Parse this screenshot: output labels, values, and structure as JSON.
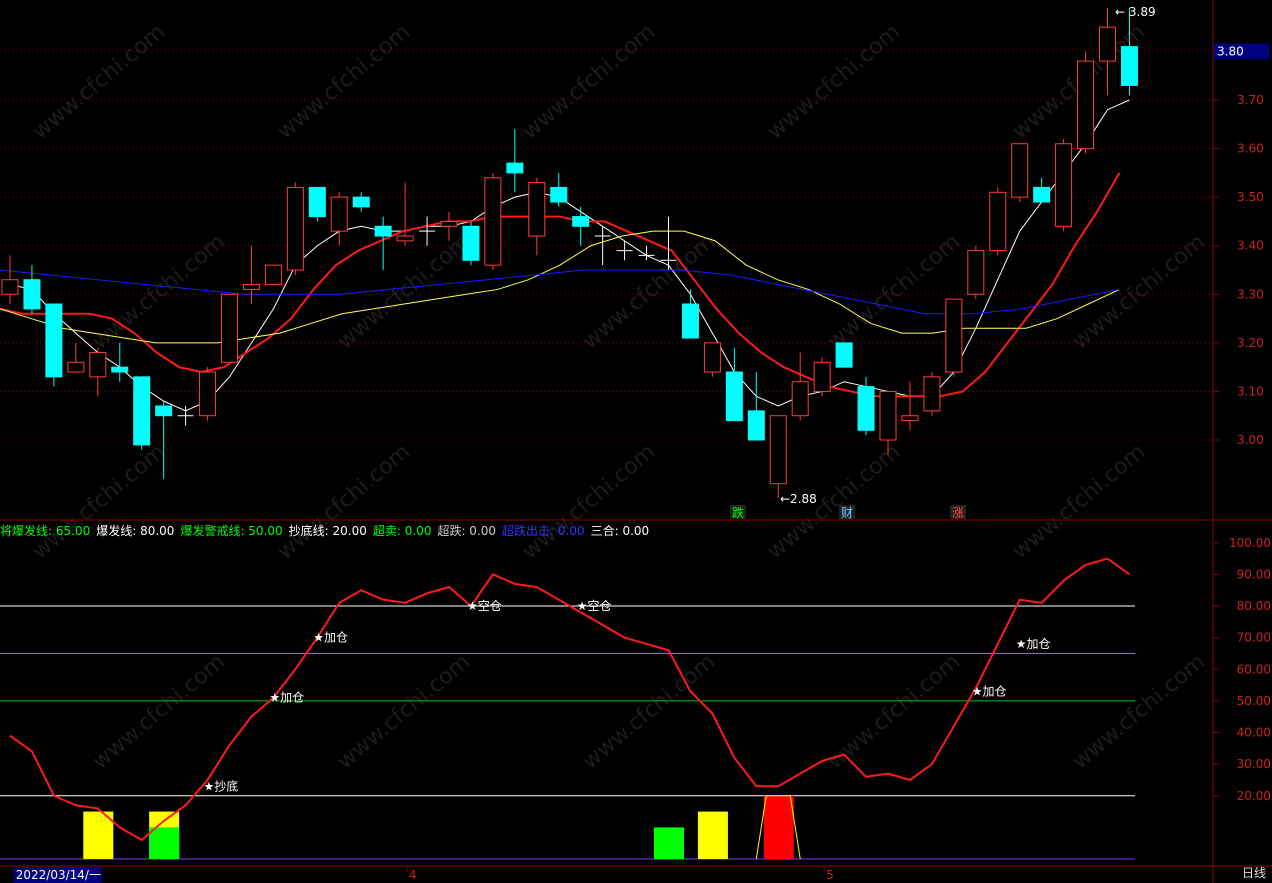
{
  "chart_data": [
    {
      "type": "candlestick",
      "yaxis": {
        "ylim": [
          2.9,
          3.95
        ],
        "ticks": [
          3.0,
          3.1,
          3.2,
          3.3,
          3.4,
          3.5,
          3.6,
          3.7
        ],
        "tick_labels": [
          "3.00",
          "3.10",
          "3.20",
          "3.30",
          "3.40",
          "3.50",
          "3.60",
          "3.70"
        ]
      },
      "price_marker": {
        "value": 3.8,
        "label": "3.80"
      },
      "candles": [
        {
          "o": 3.3,
          "h": 3.38,
          "l": 3.28,
          "c": 3.33
        },
        {
          "o": 3.33,
          "h": 3.36,
          "l": 3.26,
          "c": 3.27
        },
        {
          "o": 3.28,
          "h": 3.28,
          "l": 3.11,
          "c": 3.13
        },
        {
          "o": 3.14,
          "h": 3.2,
          "l": 3.14,
          "c": 3.16
        },
        {
          "o": 3.13,
          "h": 3.19,
          "l": 3.09,
          "c": 3.18
        },
        {
          "o": 3.15,
          "h": 3.2,
          "l": 3.12,
          "c": 3.14
        },
        {
          "o": 3.13,
          "h": 3.13,
          "l": 2.98,
          "c": 2.99
        },
        {
          "o": 3.07,
          "h": 3.08,
          "l": 2.92,
          "c": 3.05
        },
        {
          "o": 3.05,
          "h": 3.07,
          "l": 3.03,
          "c": 3.05
        },
        {
          "o": 3.05,
          "h": 3.15,
          "l": 3.04,
          "c": 3.14
        },
        {
          "o": 3.16,
          "h": 3.3,
          "l": 3.16,
          "c": 3.3
        },
        {
          "o": 3.31,
          "h": 3.4,
          "l": 3.28,
          "c": 3.32
        },
        {
          "o": 3.32,
          "h": 3.36,
          "l": 3.32,
          "c": 3.36
        },
        {
          "o": 3.35,
          "h": 3.53,
          "l": 3.34,
          "c": 3.52
        },
        {
          "o": 3.52,
          "h": 3.52,
          "l": 3.45,
          "c": 3.46
        },
        {
          "o": 3.43,
          "h": 3.51,
          "l": 3.4,
          "c": 3.5
        },
        {
          "o": 3.5,
          "h": 3.51,
          "l": 3.47,
          "c": 3.48
        },
        {
          "o": 3.44,
          "h": 3.46,
          "l": 3.35,
          "c": 3.42
        },
        {
          "o": 3.41,
          "h": 3.53,
          "l": 3.4,
          "c": 3.42
        },
        {
          "o": 3.43,
          "h": 3.46,
          "l": 3.4,
          "c": 3.43
        },
        {
          "o": 3.44,
          "h": 3.47,
          "l": 3.41,
          "c": 3.45
        },
        {
          "o": 3.44,
          "h": 3.45,
          "l": 3.36,
          "c": 3.37
        },
        {
          "o": 3.36,
          "h": 3.55,
          "l": 3.35,
          "c": 3.54
        },
        {
          "o": 3.57,
          "h": 3.64,
          "l": 3.51,
          "c": 3.55
        },
        {
          "o": 3.42,
          "h": 3.54,
          "l": 3.38,
          "c": 3.53
        },
        {
          "o": 3.52,
          "h": 3.55,
          "l": 3.48,
          "c": 3.49
        },
        {
          "o": 3.46,
          "h": 3.48,
          "l": 3.4,
          "c": 3.44
        },
        {
          "o": 3.42,
          "h": 3.44,
          "l": 3.36,
          "c": 3.42
        },
        {
          "o": 3.39,
          "h": 3.41,
          "l": 3.37,
          "c": 3.39
        },
        {
          "o": 3.38,
          "h": 3.4,
          "l": 3.37,
          "c": 3.38
        },
        {
          "o": 3.37,
          "h": 3.46,
          "l": 3.35,
          "c": 3.37
        },
        {
          "o": 3.28,
          "h": 3.31,
          "l": 3.21,
          "c": 3.21
        },
        {
          "o": 3.14,
          "h": 3.2,
          "l": 3.13,
          "c": 3.2
        },
        {
          "o": 3.14,
          "h": 3.19,
          "l": 3.04,
          "c": 3.04
        },
        {
          "o": 3.06,
          "h": 3.14,
          "l": 3.02,
          "c": 3.0
        },
        {
          "o": 2.91,
          "h": 3.04,
          "l": 2.88,
          "c": 3.05
        },
        {
          "o": 3.05,
          "h": 3.18,
          "l": 3.04,
          "c": 3.12
        },
        {
          "o": 3.1,
          "h": 3.17,
          "l": 3.09,
          "c": 3.16
        },
        {
          "o": 3.2,
          "h": 3.2,
          "l": 3.15,
          "c": 3.15
        },
        {
          "o": 3.11,
          "h": 3.13,
          "l": 3.01,
          "c": 3.02
        },
        {
          "o": 3.0,
          "h": 3.1,
          "l": 2.97,
          "c": 3.1
        },
        {
          "o": 3.04,
          "h": 3.12,
          "l": 3.02,
          "c": 3.05
        },
        {
          "o": 3.06,
          "h": 3.14,
          "l": 3.05,
          "c": 3.13
        },
        {
          "o": 3.14,
          "h": 3.29,
          "l": 3.13,
          "c": 3.29
        },
        {
          "o": 3.3,
          "h": 3.4,
          "l": 3.29,
          "c": 3.39
        },
        {
          "o": 3.39,
          "h": 3.52,
          "l": 3.38,
          "c": 3.51
        },
        {
          "o": 3.5,
          "h": 3.61,
          "l": 3.49,
          "c": 3.61
        },
        {
          "o": 3.52,
          "h": 3.54,
          "l": 3.49,
          "c": 3.49
        },
        {
          "o": 3.44,
          "h": 3.62,
          "l": 3.43,
          "c": 3.61
        },
        {
          "o": 3.6,
          "h": 3.8,
          "l": 3.59,
          "c": 3.78
        },
        {
          "o": 3.78,
          "h": 3.89,
          "l": 3.71,
          "c": 3.85
        },
        {
          "o": 3.81,
          "h": 3.89,
          "l": 3.71,
          "c": 3.73
        }
      ],
      "series": [
        {
          "color": "#ffffff",
          "values": [
            3.32,
            3.31,
            3.26,
            3.22,
            3.18,
            3.15,
            3.11,
            3.08,
            3.06,
            3.08,
            3.13,
            3.2,
            3.27,
            3.36,
            3.4,
            3.43,
            3.44,
            3.43,
            3.43,
            3.44,
            3.44,
            3.45,
            3.48,
            3.5,
            3.51,
            3.5,
            3.47,
            3.44,
            3.41,
            3.38,
            3.36,
            3.3,
            3.22,
            3.14,
            3.09,
            3.07,
            3.09,
            3.1,
            3.12,
            3.11,
            3.1,
            3.09,
            3.09,
            3.14,
            3.23,
            3.33,
            3.43,
            3.49,
            3.55,
            3.61,
            3.68,
            3.7
          ]
        },
        {
          "color": "#ff1a1a",
          "values": [
            3.27,
            3.26,
            3.26,
            3.26,
            3.26,
            3.25,
            3.22,
            3.18,
            3.15,
            3.14,
            3.15,
            3.18,
            3.21,
            3.25,
            3.31,
            3.36,
            3.39,
            3.41,
            3.43,
            3.44,
            3.45,
            3.45,
            3.46,
            3.46,
            3.46,
            3.46,
            3.45,
            3.45,
            3.43,
            3.41,
            3.39,
            3.33,
            3.27,
            3.22,
            3.18,
            3.15,
            3.13,
            3.11,
            3.1,
            3.09,
            3.09,
            3.09,
            3.09,
            3.1,
            3.14,
            3.2,
            3.26,
            3.32,
            3.4,
            3.47,
            3.55
          ]
        },
        {
          "color": "#ffff55",
          "values": [
            3.27,
            3.25,
            3.23,
            3.22,
            3.21,
            3.2,
            3.2,
            3.2,
            3.21,
            3.22,
            3.24,
            3.26,
            3.27,
            3.28,
            3.29,
            3.3,
            3.31,
            3.33,
            3.36,
            3.4,
            3.42,
            3.43,
            3.43,
            3.41,
            3.36,
            3.33,
            3.31,
            3.28,
            3.24,
            3.22,
            3.22,
            3.23,
            3.23,
            3.23,
            3.25,
            3.28,
            3.31
          ]
        },
        {
          "color": "#1a1aff",
          "values": [
            3.35,
            3.34,
            3.33,
            3.32,
            3.31,
            3.3,
            3.3,
            3.3,
            3.31,
            3.32,
            3.33,
            3.34,
            3.35,
            3.35,
            3.35,
            3.34,
            3.32,
            3.3,
            3.28,
            3.26,
            3.26,
            3.27,
            3.29,
            3.31
          ]
        }
      ],
      "annotations": [
        {
          "text": "3.89",
          "arrow": "←"
        },
        {
          "text": "2.88",
          "arrow": "←"
        },
        {
          "text": "跌",
          "color": "#00ff00"
        },
        {
          "text": "财",
          "color": "#66ccff"
        },
        {
          "text": "涨",
          "color": "#ff4444"
        }
      ]
    },
    {
      "type": "indicator",
      "legend": [
        {
          "label": "将爆发线:",
          "value": "65.00",
          "color": "#00ff00"
        },
        {
          "label": "爆发线:",
          "value": "80.00",
          "color": "#ffffff"
        },
        {
          "label": "爆发警戒线:",
          "value": "50.00",
          "color": "#00ff00"
        },
        {
          "label": "抄底线:",
          "value": "20.00",
          "color": "#ffffff"
        },
        {
          "label": "超卖:",
          "value": "0.00",
          "color": "#00ff00"
        },
        {
          "label": "超跌:",
          "value": "0.00",
          "color": "#cccccc"
        },
        {
          "label": "超跌出击:",
          "value": "0.00",
          "color": "#3333ff"
        },
        {
          "label": "三合:",
          "value": "0.00",
          "color": "#ffffff"
        }
      ],
      "yaxis": {
        "ylim": [
          0,
          105
        ],
        "ticks": [
          20,
          30,
          40,
          50,
          60,
          70,
          80,
          90,
          100
        ],
        "tick_labels": [
          "20.00",
          "30.00",
          "40.00",
          "50.00",
          "60.00",
          "70.00",
          "80.00",
          "90.00",
          "100.00"
        ]
      },
      "hlines": [
        {
          "value": 80,
          "color": "#ffffff"
        },
        {
          "value": 65,
          "color": "#00cc00"
        },
        {
          "value": 50,
          "color": "#00cc00"
        },
        {
          "value": 20,
          "color": "#ffffff"
        },
        {
          "value": 0,
          "color": "#8833ff"
        }
      ],
      "line": {
        "color": "#ff1a1a",
        "values": [
          39,
          34,
          20,
          17,
          16,
          10,
          6,
          12,
          17,
          25,
          36,
          45,
          51,
          60,
          70,
          81,
          85,
          82,
          81,
          84,
          86,
          80,
          90,
          87,
          86,
          82,
          78,
          74,
          70,
          68,
          66,
          53,
          46,
          32,
          23,
          23,
          27,
          31,
          33,
          26,
          27,
          25,
          30,
          42,
          54,
          68,
          82,
          81,
          88,
          93,
          95,
          90
        ]
      },
      "bars": [
        {
          "index": 4,
          "value": 15,
          "color": "#ffff00"
        },
        {
          "index": 7,
          "value": 15,
          "color": "#ffff00"
        },
        {
          "index": 7,
          "value": 10,
          "color": "#00ff00"
        },
        {
          "index": 30,
          "value": 10,
          "color": "#00ff00"
        },
        {
          "index": 32,
          "value": 15,
          "color": "#ffff00"
        },
        {
          "index": 35,
          "value": 20,
          "color": "#ff0000"
        }
      ],
      "labels": [
        {
          "index": 9,
          "value": 23,
          "text": "★抄底"
        },
        {
          "index": 12,
          "value": 51,
          "text": "★加仓"
        },
        {
          "index": 14,
          "value": 70,
          "text": "★加仓"
        },
        {
          "index": 21,
          "value": 80,
          "text": "★空仓"
        },
        {
          "index": 26,
          "value": 80,
          "text": "★空仓"
        },
        {
          "index": 44,
          "value": 53,
          "text": "★加仓"
        },
        {
          "index": 46,
          "value": 68,
          "text": "★加仓"
        }
      ]
    }
  ],
  "xaxis": {
    "ticks": [
      {
        "index": 5,
        "label": "2022/03/14/一",
        "highlight": true
      },
      {
        "index": 19,
        "label": "4"
      },
      {
        "index": 38,
        "label": "5"
      }
    ]
  },
  "period_tab": "日线",
  "colors": {
    "up": "#ff3b3b",
    "down": "#00ffff",
    "grid": "#8b0000",
    "axis": "#8b0000"
  },
  "watermark": "www.cfchi.com"
}
